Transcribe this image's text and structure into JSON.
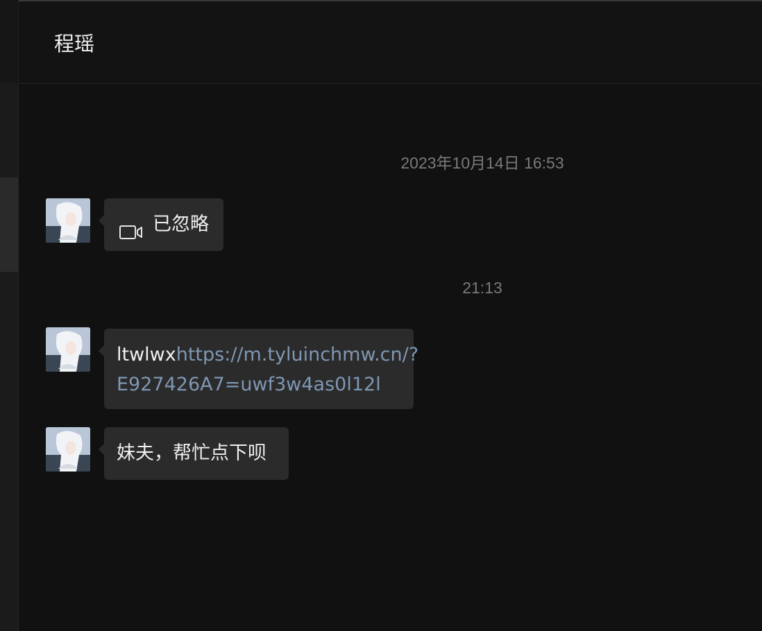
{
  "chat": {
    "title": "程瑶",
    "messages": [
      {
        "timestamp": "2023年10月14日 16:53"
      },
      {
        "icon": "video-camera-icon",
        "text": "已忽略"
      },
      {
        "timestamp": "21:13"
      },
      {
        "prefix": "ltwlwx",
        "link_line1": "https://m.tyluinchmw.cn/?",
        "link_line2": "E927426A7=uwf3w4as0l12l"
      },
      {
        "text": "妹夫，帮忙点下呗"
      }
    ]
  }
}
